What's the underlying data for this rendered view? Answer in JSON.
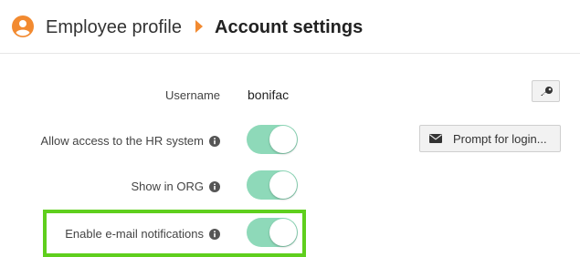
{
  "breadcrumb": {
    "root": "Employee profile",
    "current": "Account settings"
  },
  "form": {
    "username": {
      "label": "Username",
      "value": "bonifac"
    },
    "hr_access": {
      "label": "Allow access to the HR system",
      "enabled": true
    },
    "show_in_org": {
      "label": "Show in ORG",
      "enabled": true
    },
    "email_notifications": {
      "label": "Enable e-mail notifications",
      "enabled": true
    }
  },
  "actions": {
    "prompt_login_label": "Prompt for login..."
  },
  "colors": {
    "accent_orange": "#f28a30",
    "toggle_on": "#8ed9b9",
    "highlight": "#5fcf1d"
  },
  "icons": [
    "user-icon",
    "chevron-right-icon",
    "info-icon",
    "key-icon",
    "envelope-icon"
  ]
}
